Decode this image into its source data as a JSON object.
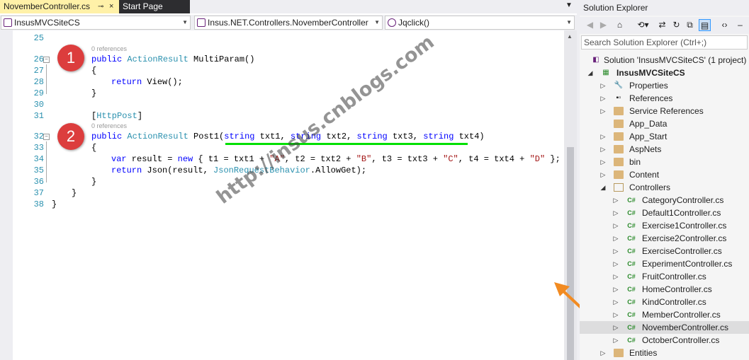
{
  "tabs": {
    "active": "NovemberController.cs",
    "pin": "⊸",
    "close": "×",
    "inactive": "Start Page",
    "dropdown": "▼"
  },
  "navbar": {
    "project": "InsusMVCSiteCS",
    "class": "Insus.NET.Controllers.NovemberController",
    "member": "Jqclick()"
  },
  "code": {
    "l25": "25",
    "r1": "0 references",
    "l26": "26",
    "l27": "27",
    "l28": "28",
    "l29": "29",
    "l30": "30",
    "l31": "31",
    "r2": "0 references",
    "l32": "32",
    "l33": "33",
    "l34": "34",
    "l35": "35",
    "l36": "36",
    "l37": "37",
    "l38": "38",
    "public1": "public",
    "ar1": "ActionResult",
    "multi": " MultiParam()",
    "brace_open": "{",
    "return1": "return",
    "view": " View();",
    "brace_close": "}",
    "lb": "[",
    "httppost": "HttpPost",
    "rb": "]",
    "public2": "public",
    "ar2": "ActionResult",
    "post1": " Post1(",
    "string1": "string",
    "txt1": " txt1, ",
    "string2": "string",
    "txt2": " txt2, ",
    "string3": "string",
    "txt3": " txt3, ",
    "string4": "string",
    "txt4": " txt4)",
    "var": "var",
    "result": " result = ",
    "new": "new",
    "l34a": " { t1 = txt1 + ",
    "sA": "\"A\"",
    "l34b": ", t2 = txt2 + ",
    "sB": "\"B\"",
    "l34c": ", t3 = txt3 + ",
    "sC": "\"C\"",
    "l34d": ", t4 = txt4 + ",
    "sD": "\"D\"",
    "l34e": " };",
    "return2": "return",
    "json": " Json(result, ",
    "jrb": "JsonRequestBehavior",
    "allow": ".AllowGet);",
    "b36": "}",
    "b37": "}",
    "b38": "}"
  },
  "badges": {
    "one": "1",
    "two": "2"
  },
  "watermark": "http://insus.cnblogs.com",
  "solution_explorer": {
    "title": "Solution Explorer",
    "search_placeholder": "Search Solution Explorer (Ctrl+;)",
    "items": [
      {
        "label": "Solution 'InsusMVCSiteCS' (1 project)"
      },
      {
        "label": "InsusMVCSiteCS"
      },
      {
        "label": "Properties"
      },
      {
        "label": "References"
      },
      {
        "label": "Service References"
      },
      {
        "label": "App_Data"
      },
      {
        "label": "App_Start"
      },
      {
        "label": "AspNets"
      },
      {
        "label": "bin"
      },
      {
        "label": "Content"
      },
      {
        "label": "Controllers"
      },
      {
        "label": "CategoryController.cs"
      },
      {
        "label": "Default1Controller.cs"
      },
      {
        "label": "Exercise1Controller.cs"
      },
      {
        "label": "Exercise2Controller.cs"
      },
      {
        "label": "ExerciseController.cs"
      },
      {
        "label": "ExperimentController.cs"
      },
      {
        "label": "FruitController.cs"
      },
      {
        "label": "HomeController.cs"
      },
      {
        "label": "KindController.cs"
      },
      {
        "label": "MemberController.cs"
      },
      {
        "label": "NovemberController.cs"
      },
      {
        "label": "OctoberController.cs"
      },
      {
        "label": "Entities"
      }
    ],
    "cs_tag": "C#"
  },
  "colors": {
    "accent_tab": "#fff1a8",
    "badge": "#dc3d3d",
    "underline": "#00e000",
    "arrow": "#f28b22",
    "selection": "#ddddde"
  }
}
